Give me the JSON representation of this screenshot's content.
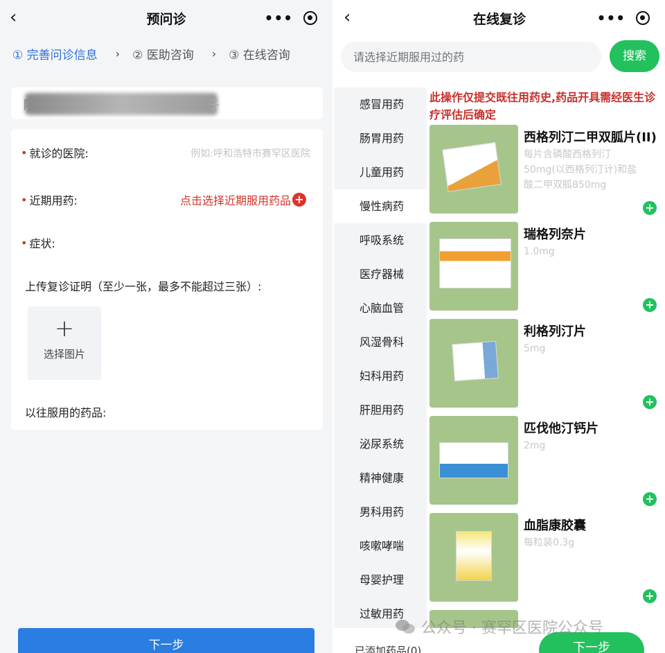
{
  "left": {
    "nav_title": "预问诊",
    "steps": [
      "① 完善问诊信息",
      "② 医助咨询",
      "③ 在线咨询"
    ],
    "blur_first_char": "阿",
    "blur_last_char": "子",
    "hospital_label": "就诊的医院:",
    "hospital_placeholder": "例如:呼和浩特市赛罕区医院",
    "medicine_label": "近期用药:",
    "medicine_pick": "点击选择近期服用药品",
    "symptom_label": "症状:",
    "upload_label": "上传复诊证明（至少一张，最多不能超过三张）:",
    "upload_button": "选择图片",
    "past_medicine_label": "以往服用的药品:",
    "next_button": "下一步"
  },
  "right": {
    "nav_title": "在线复诊",
    "search_placeholder": "请选择近期服用过的药",
    "search_button": "搜索",
    "categories": [
      "感冒用药",
      "肠胃用药",
      "儿童用药",
      "慢性病药",
      "呼吸系统",
      "医疗器械",
      "心脑血管",
      "风湿骨科",
      "妇科用药",
      "肝胆用药",
      "泌尿系统",
      "精神健康",
      "男科用药",
      "咳嗽哮喘",
      "母婴护理",
      "过敏用药"
    ],
    "active_category": "慢性病药",
    "notice": "此操作仅提交既往用药史,药品开具需经医生诊疗评估后确定",
    "drugs": [
      {
        "name": "西格列汀二甲双胍片(II)",
        "spec": "每片含磷酸西格列汀50mg(以西格列汀计)和盐酸二甲双胍850mg"
      },
      {
        "name": "瑞格列奈片",
        "spec": "1.0mg"
      },
      {
        "name": "利格列汀片",
        "spec": "5mg"
      },
      {
        "name": "匹伐他汀钙片",
        "spec": "2mg"
      },
      {
        "name": "血脂康胶囊",
        "spec": "每粒装0.3g"
      }
    ],
    "added_count_text": "已添加药品(0)",
    "next_button": "下一步"
  },
  "watermark": "公众号 · 赛罕区医院公众号",
  "colors": {
    "blue": "#2a7de1",
    "green": "#22c15e",
    "red": "#d0362b"
  }
}
